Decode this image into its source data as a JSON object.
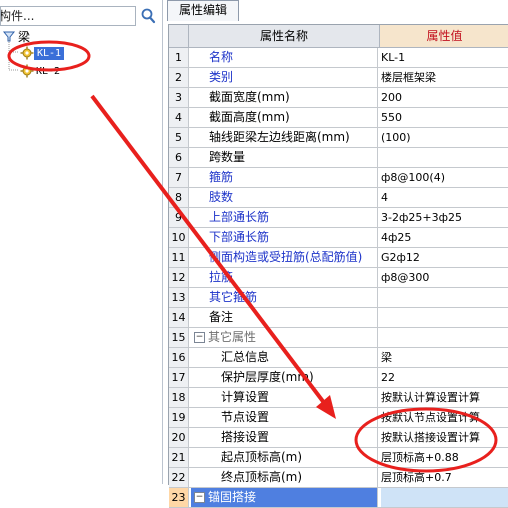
{
  "search": {
    "placeholder": "索构件..."
  },
  "tree": {
    "root": "梁",
    "items": [
      {
        "label": "KL-1",
        "selected": true
      },
      {
        "label": "KL-2",
        "selected": false
      }
    ]
  },
  "panel": {
    "tab_title": "属性编辑"
  },
  "grid": {
    "col_name": "属性名称",
    "col_value": "属性值",
    "rows": [
      {
        "num": "1",
        "name": "名称",
        "value": "KL-1"
      },
      {
        "num": "2",
        "name": "类别",
        "value": "楼层框架梁"
      },
      {
        "num": "3",
        "name": "截面宽度(mm)",
        "value": "200"
      },
      {
        "num": "4",
        "name": "截面高度(mm)",
        "value": "550"
      },
      {
        "num": "5",
        "name": "轴线距梁左边线距离(mm)",
        "value": "(100)"
      },
      {
        "num": "6",
        "name": "跨数量",
        "value": ""
      },
      {
        "num": "7",
        "name": "箍筋",
        "value": "ф8@100(4)"
      },
      {
        "num": "8",
        "name": "肢数",
        "value": "4"
      },
      {
        "num": "9",
        "name": "上部通长筋",
        "value": "3-2ф25+3ф25"
      },
      {
        "num": "10",
        "name": "下部通长筋",
        "value": "4ф25"
      },
      {
        "num": "11",
        "name": "侧面构造或受扭筋(总配筋值)",
        "value": "G2ф12"
      },
      {
        "num": "12",
        "name": "拉筋",
        "value": "ф8@300"
      },
      {
        "num": "13",
        "name": "其它箍筋",
        "value": ""
      },
      {
        "num": "14",
        "name": "备注",
        "value": ""
      },
      {
        "num": "15",
        "name": "其它属性",
        "value": ""
      },
      {
        "num": "16",
        "name": "汇总信息",
        "value": "梁"
      },
      {
        "num": "17",
        "name": "保护层厚度(mm)",
        "value": "22"
      },
      {
        "num": "18",
        "name": "计算设置",
        "value": "按默认计算设置计算"
      },
      {
        "num": "19",
        "name": "节点设置",
        "value": "按默认节点设置计算"
      },
      {
        "num": "20",
        "name": "搭接设置",
        "value": "按默认搭接设置计算"
      },
      {
        "num": "21",
        "name": "起点顶标高(m)",
        "value": "层顶标高+0.88"
      },
      {
        "num": "22",
        "name": "终点顶标高(m)",
        "value": "层顶标高+0.7"
      },
      {
        "num": "23",
        "name": "锚固搭接",
        "value": ""
      }
    ]
  },
  "colors": {
    "accent_red": "#e8201d",
    "select_blue": "#3a6fd8",
    "label_blue": "#1d33c9"
  }
}
